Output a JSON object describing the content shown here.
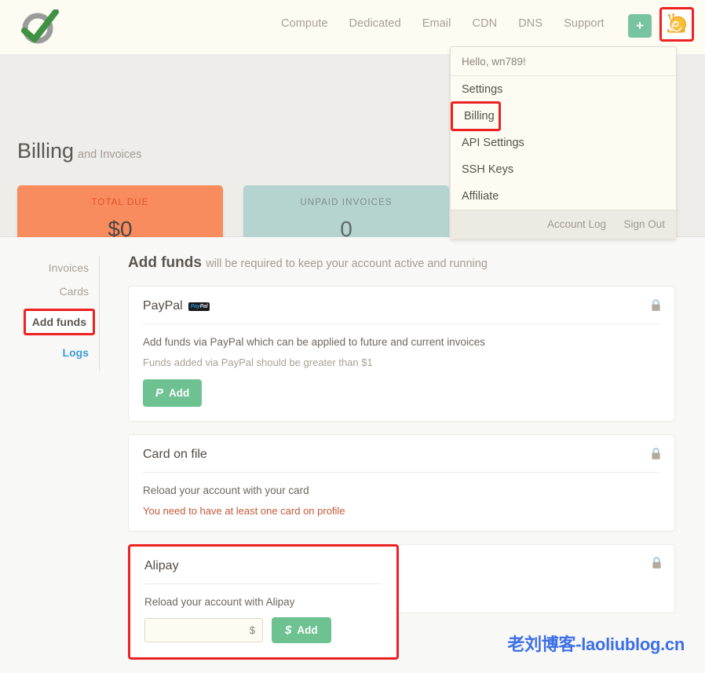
{
  "header": {
    "logo_icon": "vultr-logo-icon",
    "nav": [
      {
        "label": "Compute"
      },
      {
        "label": "Dedicated"
      },
      {
        "label": "Email"
      },
      {
        "label": "CDN"
      },
      {
        "label": "DNS"
      },
      {
        "label": "Support"
      }
    ],
    "add_button_label": "+",
    "avatar_icon": "snail-avatar-icon"
  },
  "dropdown": {
    "greeting": "Hello, wn789!",
    "items": [
      {
        "label": "Settings",
        "highlighted": false
      },
      {
        "label": "Billing",
        "highlighted": true
      },
      {
        "label": "API Settings",
        "highlighted": false
      },
      {
        "label": "SSH Keys",
        "highlighted": false
      },
      {
        "label": "Affiliate",
        "highlighted": false
      }
    ],
    "footer": [
      {
        "label": "Account Log"
      },
      {
        "label": "Sign Out"
      }
    ]
  },
  "banner": {
    "title": "Billing",
    "subtitle": "and Invoices",
    "stats": [
      {
        "label": "TOTAL DUE",
        "value": "$0",
        "color": "#f98c5e"
      },
      {
        "label": "UNPAID INVOICES",
        "value": "0",
        "color": "#b5d4cf"
      }
    ]
  },
  "sidebar": {
    "items": [
      {
        "label": "Invoices",
        "state": "normal"
      },
      {
        "label": "Cards",
        "state": "normal"
      },
      {
        "label": "Add funds",
        "state": "active-highlighted"
      },
      {
        "label": "Logs",
        "state": "link"
      }
    ]
  },
  "main": {
    "heading": "Add funds",
    "heading_sub": "will be required to keep your account active and running",
    "cards": [
      {
        "title": "PayPal",
        "badge": "PayPal",
        "lock_icon": "lock-icon",
        "description": "Add funds via PayPal which can be applied to future and current invoices",
        "note": "Funds added via PayPal should be greater than $1",
        "note_error": false,
        "button_label": "Add",
        "button_icon": "paypal-p-icon"
      },
      {
        "title": "Card on file",
        "lock_icon": "lock-icon",
        "description": "Reload your account with your card",
        "note": "You need to have at least one card on profile",
        "note_error": true
      },
      {
        "title": "Alipay",
        "lock_icon": "lock-icon",
        "description": "Reload your account with Alipay",
        "input_value": "",
        "input_placeholder": "",
        "input_suffix": "$",
        "button_label": "Add",
        "button_icon": "dollar-icon",
        "button_prefix": "$",
        "highlighted": true
      }
    ]
  },
  "watermark": {
    "text": "老刘博客-laoliublog.cn",
    "color": "#3d6fe8"
  },
  "colors": {
    "accent_green": "#6ec292",
    "highlight_red": "#ee2222",
    "total_due_card": "#f98c5e",
    "unpaid_card": "#b5d4cf",
    "link_blue": "#3e9bd6"
  }
}
